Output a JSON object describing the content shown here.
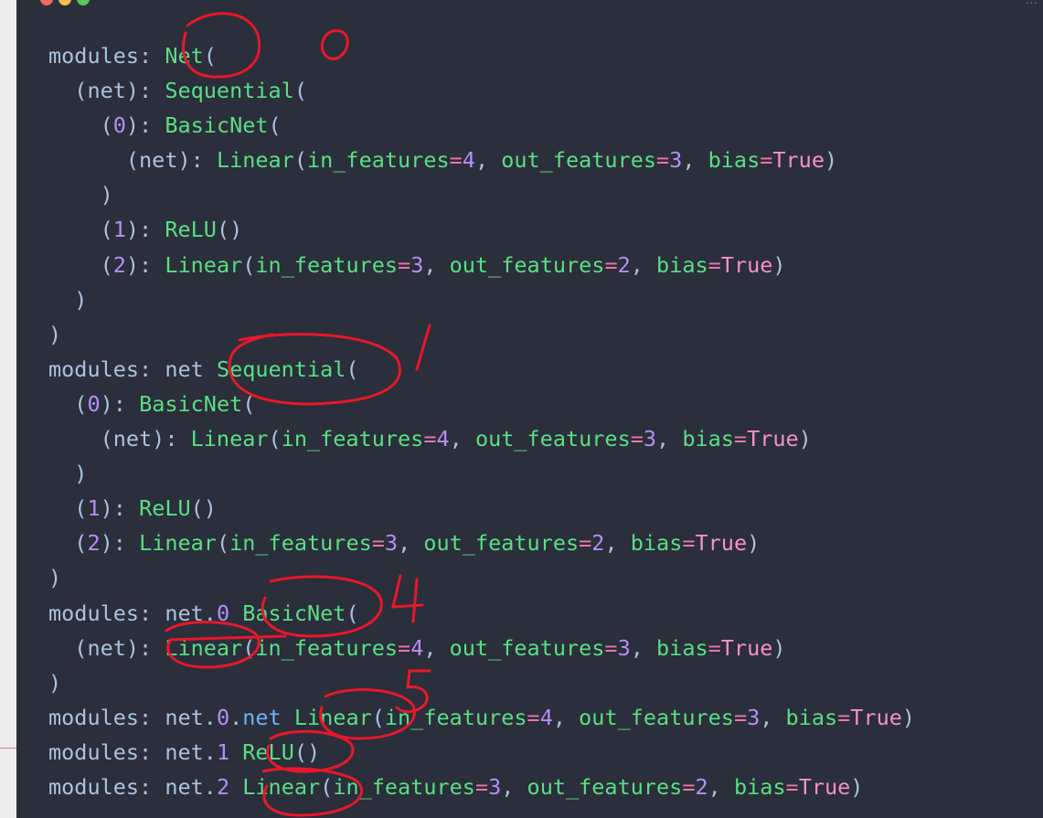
{
  "window": {
    "traffic_lights": [
      "close",
      "minimize",
      "maximize"
    ],
    "title_fragment": "..."
  },
  "code_lines": [
    [
      [
        "modules: ",
        "kw"
      ],
      [
        "Net",
        "cls"
      ],
      [
        "(",
        "kw"
      ]
    ],
    [
      [
        "  (net): ",
        "kw"
      ],
      [
        "Sequential",
        "cls"
      ],
      [
        "(",
        "kw"
      ]
    ],
    [
      [
        "    (",
        "kw"
      ],
      [
        "0",
        "num"
      ],
      [
        "): ",
        "kw"
      ],
      [
        "BasicNet",
        "cls"
      ],
      [
        "(",
        "kw"
      ]
    ],
    [
      [
        "      (net): ",
        "kw"
      ],
      [
        "Linear",
        "cls"
      ],
      [
        "(",
        "kw"
      ],
      [
        "in_features",
        "cls"
      ],
      [
        "=",
        "eq"
      ],
      [
        "4",
        "num"
      ],
      [
        ", ",
        "kw"
      ],
      [
        "out_features",
        "cls"
      ],
      [
        "=",
        "eq"
      ],
      [
        "3",
        "num"
      ],
      [
        ", ",
        "kw"
      ],
      [
        "bias",
        "cls"
      ],
      [
        "=",
        "eq"
      ],
      [
        "True",
        "bool"
      ],
      [
        ")",
        "kw"
      ]
    ],
    [
      [
        "    )",
        "kw"
      ]
    ],
    [
      [
        "    (",
        "kw"
      ],
      [
        "1",
        "num"
      ],
      [
        "): ",
        "kw"
      ],
      [
        "ReLU",
        "cls"
      ],
      [
        "()",
        "kw"
      ]
    ],
    [
      [
        "    (",
        "kw"
      ],
      [
        "2",
        "num"
      ],
      [
        "): ",
        "kw"
      ],
      [
        "Linear",
        "cls"
      ],
      [
        "(",
        "kw"
      ],
      [
        "in_features",
        "cls"
      ],
      [
        "=",
        "eq"
      ],
      [
        "3",
        "num"
      ],
      [
        ", ",
        "kw"
      ],
      [
        "out_features",
        "cls"
      ],
      [
        "=",
        "eq"
      ],
      [
        "2",
        "num"
      ],
      [
        ", ",
        "kw"
      ],
      [
        "bias",
        "cls"
      ],
      [
        "=",
        "eq"
      ],
      [
        "True",
        "bool"
      ],
      [
        ")",
        "kw"
      ]
    ],
    [
      [
        "  )",
        "kw"
      ]
    ],
    [
      [
        ")",
        "kw"
      ]
    ],
    [
      [
        "modules: net ",
        "kw"
      ],
      [
        "Sequential",
        "cls"
      ],
      [
        "(",
        "kw"
      ]
    ],
    [
      [
        "  (",
        "kw"
      ],
      [
        "0",
        "num"
      ],
      [
        "): ",
        "kw"
      ],
      [
        "BasicNet",
        "cls"
      ],
      [
        "(",
        "kw"
      ]
    ],
    [
      [
        "    (net): ",
        "kw"
      ],
      [
        "Linear",
        "cls"
      ],
      [
        "(",
        "kw"
      ],
      [
        "in_features",
        "cls"
      ],
      [
        "=",
        "eq"
      ],
      [
        "4",
        "num"
      ],
      [
        ", ",
        "kw"
      ],
      [
        "out_features",
        "cls"
      ],
      [
        "=",
        "eq"
      ],
      [
        "3",
        "num"
      ],
      [
        ", ",
        "kw"
      ],
      [
        "bias",
        "cls"
      ],
      [
        "=",
        "eq"
      ],
      [
        "True",
        "bool"
      ],
      [
        ")",
        "kw"
      ]
    ],
    [
      [
        "  )",
        "kw"
      ]
    ],
    [
      [
        "  (",
        "kw"
      ],
      [
        "1",
        "num"
      ],
      [
        "): ",
        "kw"
      ],
      [
        "ReLU",
        "cls"
      ],
      [
        "()",
        "kw"
      ]
    ],
    [
      [
        "  (",
        "kw"
      ],
      [
        "2",
        "num"
      ],
      [
        "): ",
        "kw"
      ],
      [
        "Linear",
        "cls"
      ],
      [
        "(",
        "kw"
      ],
      [
        "in_features",
        "cls"
      ],
      [
        "=",
        "eq"
      ],
      [
        "3",
        "num"
      ],
      [
        ", ",
        "kw"
      ],
      [
        "out_features",
        "cls"
      ],
      [
        "=",
        "eq"
      ],
      [
        "2",
        "num"
      ],
      [
        ", ",
        "kw"
      ],
      [
        "bias",
        "cls"
      ],
      [
        "=",
        "eq"
      ],
      [
        "True",
        "bool"
      ],
      [
        ")",
        "kw"
      ]
    ],
    [
      [
        ")",
        "kw"
      ]
    ],
    [
      [
        "modules: net.",
        "kw"
      ],
      [
        "0",
        "num"
      ],
      [
        " ",
        "kw"
      ],
      [
        "BasicNet",
        "cls"
      ],
      [
        "(",
        "kw"
      ]
    ],
    [
      [
        "  (net): ",
        "kw"
      ],
      [
        "Linear",
        "cls"
      ],
      [
        "(",
        "kw"
      ],
      [
        "in_features",
        "cls"
      ],
      [
        "=",
        "eq"
      ],
      [
        "4",
        "num"
      ],
      [
        ", ",
        "kw"
      ],
      [
        "out_features",
        "cls"
      ],
      [
        "=",
        "eq"
      ],
      [
        "3",
        "num"
      ],
      [
        ", ",
        "kw"
      ],
      [
        "bias",
        "cls"
      ],
      [
        "=",
        "eq"
      ],
      [
        "True",
        "bool"
      ],
      [
        ")",
        "kw"
      ]
    ],
    [
      [
        ")",
        "kw"
      ]
    ],
    [
      [
        "modules: net.",
        "kw"
      ],
      [
        "0",
        "num"
      ],
      [
        ".",
        "kw"
      ],
      [
        "net",
        "attr"
      ],
      [
        " ",
        "kw"
      ],
      [
        "Linear",
        "cls"
      ],
      [
        "(",
        "kw"
      ],
      [
        "in_features",
        "cls"
      ],
      [
        "=",
        "eq"
      ],
      [
        "4",
        "num"
      ],
      [
        ", ",
        "kw"
      ],
      [
        "out_features",
        "cls"
      ],
      [
        "=",
        "eq"
      ],
      [
        "3",
        "num"
      ],
      [
        ", ",
        "kw"
      ],
      [
        "bias",
        "cls"
      ],
      [
        "=",
        "eq"
      ],
      [
        "True",
        "bool"
      ],
      [
        ")",
        "kw"
      ]
    ],
    [
      [
        "modules: net.",
        "kw"
      ],
      [
        "1",
        "num"
      ],
      [
        " ",
        "kw"
      ],
      [
        "ReLU",
        "cls"
      ],
      [
        "()",
        "kw"
      ]
    ],
    [
      [
        "modules: net.",
        "kw"
      ],
      [
        "2",
        "num"
      ],
      [
        " ",
        "kw"
      ],
      [
        "Linear",
        "cls"
      ],
      [
        "(",
        "kw"
      ],
      [
        "in_features",
        "cls"
      ],
      [
        "=",
        "eq"
      ],
      [
        "3",
        "num"
      ],
      [
        ", ",
        "kw"
      ],
      [
        "out_features",
        "cls"
      ],
      [
        "=",
        "eq"
      ],
      [
        "2",
        "num"
      ],
      [
        ", ",
        "kw"
      ],
      [
        "bias",
        "cls"
      ],
      [
        "=",
        "eq"
      ],
      [
        "True",
        "bool"
      ],
      [
        ")",
        "kw"
      ]
    ]
  ],
  "handwritten_annotations": [
    "0",
    "1",
    "4",
    "5"
  ],
  "colors": {
    "background": "#2b2e3b",
    "plain": "#a9c4de",
    "class": "#59df86",
    "number": "#b58ef6",
    "boolean": "#f492c8",
    "attribute": "#6fb1f6",
    "operator": "#e879a8",
    "annotation_ink": "#e8182b"
  }
}
